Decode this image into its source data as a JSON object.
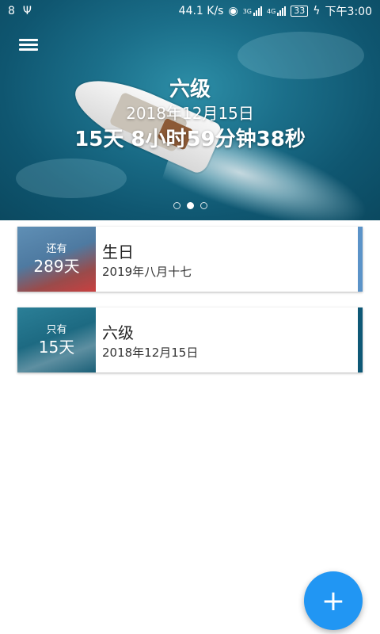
{
  "status_bar": {
    "left_icons": [
      "notification-icon",
      "usb-icon"
    ],
    "speed": "44.1 K/s",
    "signal_1_label": "3G",
    "signal_2_label": "4G",
    "battery": "33",
    "time": "下午3:00"
  },
  "hero": {
    "title": "六级",
    "date": "2018年12月15日",
    "countdown": "15天 8小时59分钟38秒",
    "pages": 3,
    "active_page": 2
  },
  "events": [
    {
      "prefix": "还有",
      "count": "289天",
      "name": "生日",
      "date": "2019年八月十七",
      "accent": "#5b93c8"
    },
    {
      "prefix": "只有",
      "count": "15天",
      "name": "六级",
      "date": "2018年12月15日",
      "accent": "#0e5876"
    }
  ],
  "fab": {
    "label": "+"
  },
  "colors": {
    "primary": "#2196f3",
    "hero": "#1b6f8a"
  }
}
